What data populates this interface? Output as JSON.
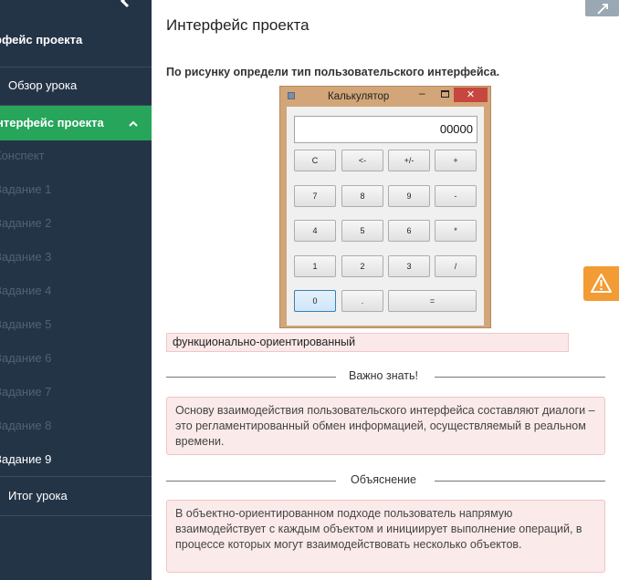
{
  "sidebar": {
    "back_icon": "arrow-left-icon",
    "section_title": "рфейс проекта",
    "overview": "Обзор урока",
    "active_item": "нтерфейс проекта",
    "sub_items": [
      "Конспект",
      "Задание 1",
      "Задание 2",
      "Задание 3",
      "Задание 4",
      "Задание 5",
      "Задание 6",
      "Задание 7",
      "Задание 8",
      "Задание 9"
    ],
    "final": "Итог урока"
  },
  "main": {
    "title": "Интерфейс проекта",
    "question": "По рисунку определи тип пользовательского интерфейса.",
    "answer": "функционально-ориентированный",
    "important_label": "Важно знать!",
    "important_text": "Основу взаимодействия пользовательского интерфейса составляют диалоги – это регламентированный обмен информацией, осуществляемый в реальном времени.",
    "explanation_label": "Объяснение",
    "explanation_text": "В объектно-ориентированном подходе пользователь напрямую взаимодействует с каждым объектом и инициирует выполнение операций, в процессе которых могут взаимодействовать несколько объектов."
  },
  "calculator": {
    "title": "Калькулятор",
    "display": "00000",
    "keys": [
      "C",
      "<-",
      "+/-",
      "+",
      "7",
      "8",
      "9",
      "-",
      "4",
      "5",
      "6",
      "*",
      "1",
      "2",
      "3",
      "/",
      "0",
      ".",
      "="
    ]
  },
  "colors": {
    "sidebar_bg": "#243447",
    "active_green": "#27a55b",
    "warning_orange": "#f39b34",
    "info_bg": "#fbeaea"
  }
}
